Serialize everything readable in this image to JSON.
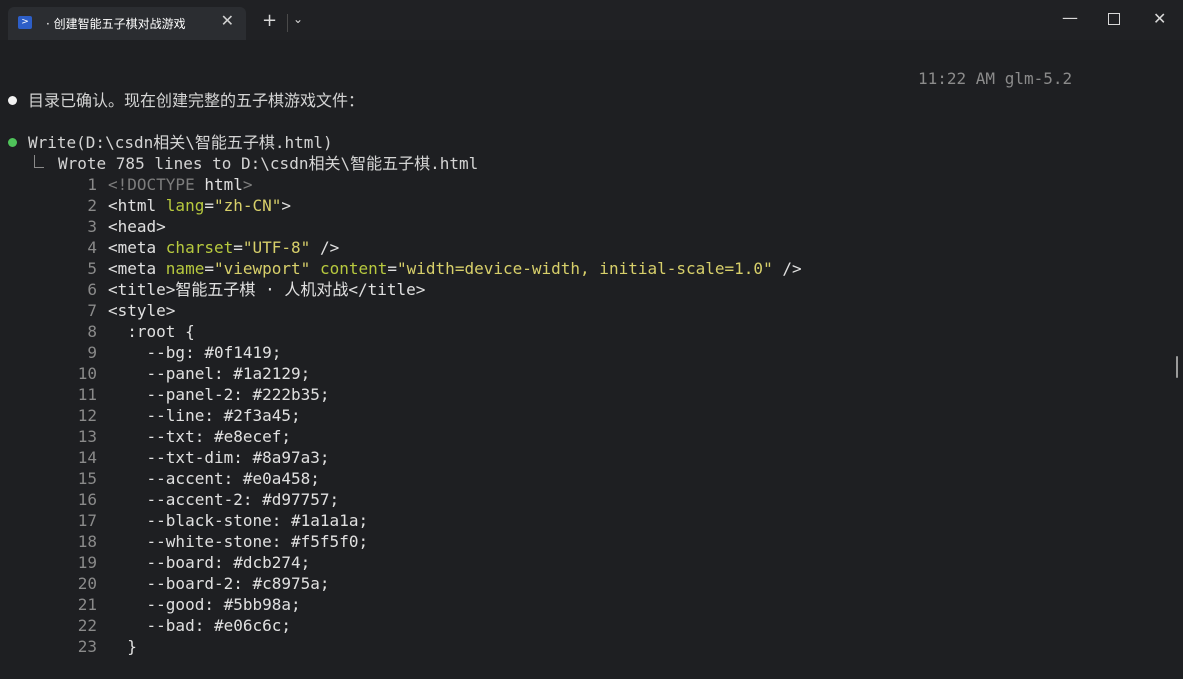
{
  "window": {
    "tab_title": "· 创建智能五子棋对战游戏",
    "tab_icon": "powershell-icon",
    "close_glyph": "✕",
    "new_tab_glyph": "+",
    "dropdown_glyph": "⌄",
    "min_glyph": "—",
    "close_win_glyph": "✕"
  },
  "terminal": {
    "meta": "11:22 AM glm-5.2",
    "message1": "目录已确认。现在创建完整的五子棋游戏文件：",
    "tool_call": "Write(D:\\csdn相关\\智能五子棋.html)",
    "tool_result": "Wrote 785 lines to D:\\csdn相关\\智能五子棋.html",
    "line_numbers": [
      "1",
      "2",
      "3",
      "4",
      "5",
      "6",
      "7",
      "8",
      "9",
      "10",
      "11",
      "12",
      "13",
      "14",
      "15",
      "16",
      "17",
      "18",
      "19",
      "20",
      "21",
      "22",
      "23"
    ],
    "code": {
      "l1a": "<!DOCTYPE",
      "l1b": " html",
      "l1c": ">",
      "l2a": "<html ",
      "l2b": "lang",
      "l2c": "=",
      "l2d": "\"zh-CN\"",
      "l2e": ">",
      "l3": "<head>",
      "l4a": "<meta ",
      "l4b": "charset",
      "l4c": "=",
      "l4d": "\"UTF-8\"",
      "l4e": " />",
      "l5a": "<meta ",
      "l5b": "name",
      "l5c": "=",
      "l5d": "\"viewport\"",
      "l5e": " ",
      "l5f": "content",
      "l5g": "=",
      "l5h": "\"width=device-width, initial-scale=1.0\"",
      "l5i": " />",
      "l6": "<title>智能五子棋 · 人机对战</title>",
      "l7": "<style>",
      "l8": "  :root {",
      "l9": "    --bg: #0f1419;",
      "l10": "    --panel: #1a2129;",
      "l11": "    --panel-2: #222b35;",
      "l12": "    --line: #2f3a45;",
      "l13": "    --txt: #e8ecef;",
      "l14": "    --txt-dim: #8a97a3;",
      "l15": "    --accent: #e0a458;",
      "l16": "    --accent-2: #d97757;",
      "l17": "    --black-stone: #1a1a1a;",
      "l18": "    --white-stone: #f5f5f0;",
      "l19": "    --board: #dcb274;",
      "l20": "    --board-2: #c8975a;",
      "l21": "    --good: #5bb98a;",
      "l22": "    --bad: #e06c6c;",
      "l23": "  }"
    }
  }
}
